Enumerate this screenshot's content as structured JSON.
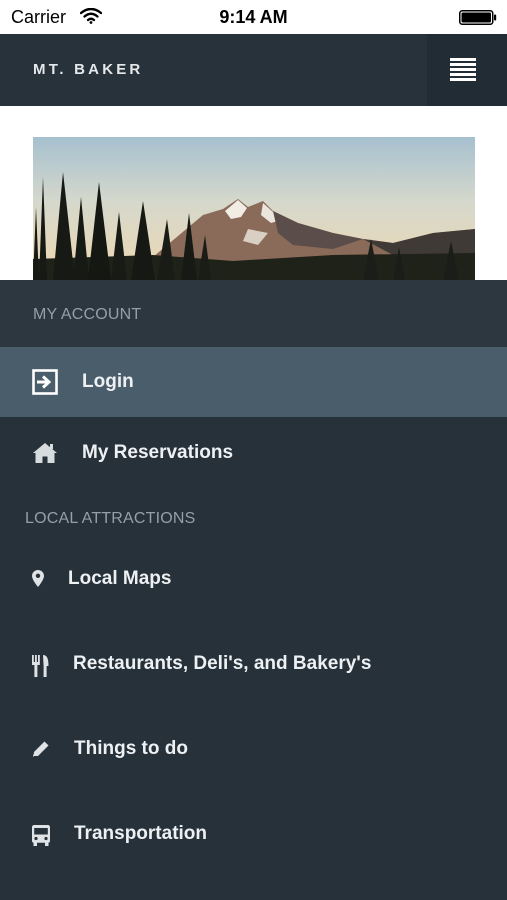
{
  "status_bar": {
    "carrier": "Carrier",
    "time": "9:14 AM"
  },
  "header": {
    "title": "MT. BAKER",
    "menu_icon": "hamburger-icon"
  },
  "hero": {
    "image": "mountain-landscape"
  },
  "drawer": {
    "my_account_label": "MY ACCOUNT",
    "my_account_items": [
      {
        "label": "Login",
        "icon": "login-icon",
        "selected": true
      },
      {
        "label": "My Reservations",
        "icon": "home-icon",
        "selected": false
      }
    ],
    "local_attractions_label": "LOCAL ATTRACTIONS",
    "local_items": [
      {
        "label": "Local Maps",
        "icon": "map-pin-icon"
      },
      {
        "label": "Restaurants, Deli's, and Bakery's",
        "icon": "fork-knife-icon"
      },
      {
        "label": "Things to do",
        "icon": "pencil-icon"
      },
      {
        "label": "Transportation",
        "icon": "bus-icon"
      }
    ]
  },
  "colors": {
    "header_bg": "#27323b",
    "drawer_bg": "#26313a",
    "selected_bg": "#4a5d6a",
    "section_text": "#93a0a8",
    "item_text": "#eef1f3"
  }
}
